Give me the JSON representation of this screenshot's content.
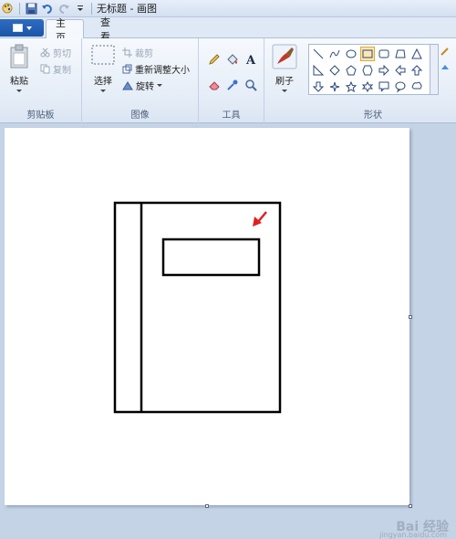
{
  "window": {
    "title": "无标题 - 画图"
  },
  "tabs": [
    {
      "label": "主页",
      "active": true
    },
    {
      "label": "查看",
      "active": false
    }
  ],
  "ribbon": {
    "clipboard": {
      "paste": "粘贴",
      "cut": "剪切",
      "copy": "复制",
      "label": "剪贴板"
    },
    "image": {
      "select": "选择",
      "crop": "裁剪",
      "resize": "重新调整大小",
      "rotate": "旋转",
      "label": "图像"
    },
    "tools": {
      "label": "工具",
      "icons": [
        "pencil-icon",
        "fill-icon",
        "text-icon",
        "eraser-icon",
        "color-picker-icon",
        "magnifier-icon"
      ]
    },
    "brushes": {
      "label": "刷子"
    },
    "shapes": {
      "label": "形状"
    }
  },
  "colors": {
    "accent": "#2e6cc3",
    "arrow": "#e02020",
    "selected_shape": "#e1a838"
  },
  "watermark": {
    "text": "Bai 经验",
    "sub": "jingyan.baidu.com"
  }
}
